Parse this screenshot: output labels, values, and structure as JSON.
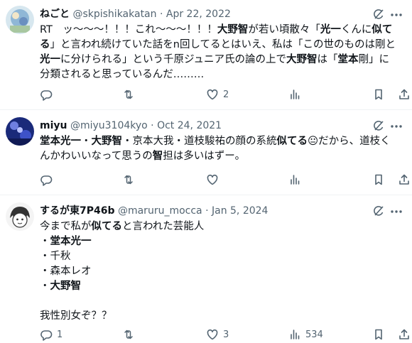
{
  "tweets": [
    {
      "name": "ねごと",
      "handle": "@skpishikakatan",
      "sep": "·",
      "date": "Apr 22, 2022",
      "lines": [
        [
          [
            "RT　ッ〜〜〜！！！これ〜〜〜！！！",
            false
          ],
          [
            "大野智",
            true
          ],
          [
            "が若い頃散々「",
            false
          ],
          [
            "光一",
            true
          ],
          [
            "くんに",
            false
          ],
          [
            "似て",
            true
          ]
        ],
        [
          [
            "る",
            true
          ],
          [
            "」と言われ続けていた話をn回してるとはいえ、私は「この世のものは剛と",
            false
          ]
        ],
        [
          [
            "光一",
            true
          ],
          [
            "に分けられる」という千原ジュニア氏の論の上で",
            false
          ],
          [
            "大野智",
            true
          ],
          [
            "は「",
            false
          ],
          [
            "堂本",
            true
          ],
          [
            "剛」に",
            false
          ]
        ],
        [
          [
            "分類されると思っているんだ………",
            false
          ]
        ]
      ],
      "counts": {
        "reply": "",
        "retweet": "",
        "like": "2",
        "views": ""
      }
    },
    {
      "name": "miyu",
      "handle": "@miyu3104kyo",
      "sep": "·",
      "date": "Oct 24, 2021",
      "lines": [
        [
          [
            "堂本光一",
            true
          ],
          [
            "・",
            false
          ],
          [
            "大野智",
            true
          ],
          [
            "・京本大我・道枝駿祐の顔の系統",
            false
          ],
          [
            "似てる",
            true
          ],
          [
            "😐",
            false
          ],
          [
            "だから、道枝く",
            false
          ]
        ],
        [
          [
            "んかわいいなって思うの",
            false
          ],
          [
            "智",
            true
          ],
          [
            "担は多いはずー。",
            false
          ]
        ]
      ],
      "counts": {
        "reply": "",
        "retweet": "",
        "like": "",
        "views": ""
      }
    },
    {
      "name": "するが東7P46b",
      "handle": "@maruru_mocca",
      "sep": "·",
      "date": "Jan 5, 2024",
      "lines": [
        [
          [
            "今まで私が",
            false
          ],
          [
            "似てる",
            true
          ],
          [
            "と言われた芸能人",
            false
          ]
        ],
        [
          [
            "・",
            false
          ],
          [
            "堂本光一",
            true
          ]
        ],
        [
          [
            "・千秋",
            false
          ]
        ],
        [
          [
            "・森本レオ",
            false
          ]
        ],
        [
          [
            "・",
            false
          ],
          [
            "大野智",
            true
          ]
        ],
        [],
        [
          [
            "我性別女ぞ？？",
            false
          ]
        ]
      ],
      "counts": {
        "reply": "1",
        "retweet": "",
        "like": "3",
        "views": "534"
      }
    }
  ],
  "icons": [
    "grok-icon",
    "more-icon",
    "reply-icon",
    "retweet-icon",
    "like-icon",
    "views-icon",
    "bookmark-icon",
    "share-icon"
  ],
  "colors": {
    "text": "#0f1419",
    "secondary": "#536471",
    "divider": "#eff3f4"
  }
}
